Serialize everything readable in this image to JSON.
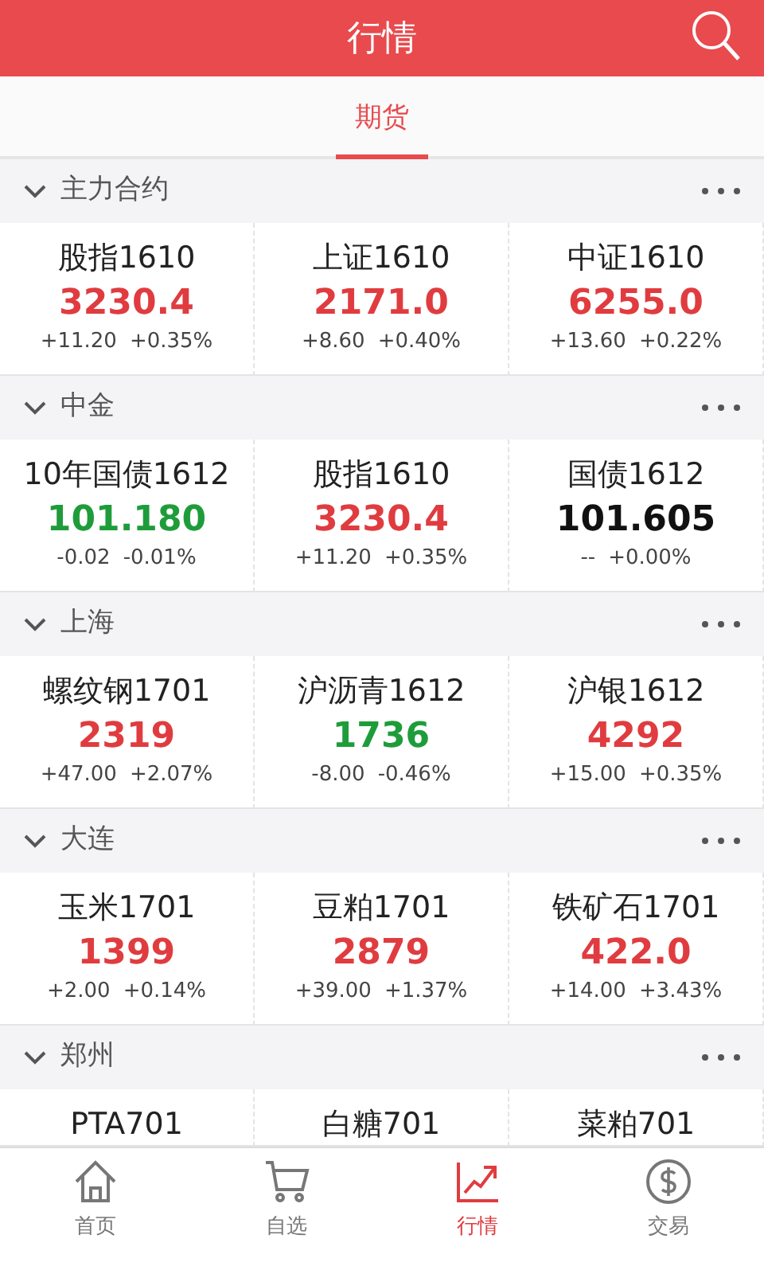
{
  "header": {
    "title": "行情"
  },
  "tabs": [
    {
      "label": "期货",
      "selected": true
    }
  ],
  "sections": [
    {
      "title": "主力合约",
      "expanded": true,
      "quotes": [
        {
          "name": "股指1610",
          "price": "3230.4",
          "change": "+11.20",
          "percent": "+0.35%",
          "kind": "up"
        },
        {
          "name": "上证1610",
          "price": "2171.0",
          "change": "+8.60",
          "percent": "+0.40%",
          "kind": "up"
        },
        {
          "name": "中证1610",
          "price": "6255.0",
          "change": "+13.60",
          "percent": "+0.22%",
          "kind": "up"
        }
      ]
    },
    {
      "title": "中金",
      "expanded": true,
      "quotes": [
        {
          "name": "10年国债1612",
          "price": "101.180",
          "change": "-0.02",
          "percent": "-0.01%",
          "kind": "down"
        },
        {
          "name": "股指1610",
          "price": "3230.4",
          "change": "+11.20",
          "percent": "+0.35%",
          "kind": "up"
        },
        {
          "name": "国债1612",
          "price": "101.605",
          "change": "--",
          "percent": "+0.00%",
          "kind": "flat"
        }
      ]
    },
    {
      "title": "上海",
      "expanded": true,
      "quotes": [
        {
          "name": "螺纹钢1701",
          "price": "2319",
          "change": "+47.00",
          "percent": "+2.07%",
          "kind": "up"
        },
        {
          "name": "沪沥青1612",
          "price": "1736",
          "change": "-8.00",
          "percent": "-0.46%",
          "kind": "down"
        },
        {
          "name": "沪银1612",
          "price": "4292",
          "change": "+15.00",
          "percent": "+0.35%",
          "kind": "up"
        }
      ]
    },
    {
      "title": "大连",
      "expanded": true,
      "quotes": [
        {
          "name": "玉米1701",
          "price": "1399",
          "change": "+2.00",
          "percent": "+0.14%",
          "kind": "up"
        },
        {
          "name": "豆粕1701",
          "price": "2879",
          "change": "+39.00",
          "percent": "+1.37%",
          "kind": "up"
        },
        {
          "name": "铁矿石1701",
          "price": "422.0",
          "change": "+14.00",
          "percent": "+3.43%",
          "kind": "up"
        }
      ]
    },
    {
      "title": "郑州",
      "expanded": true,
      "quotes": [
        {
          "name": "PTA701"
        },
        {
          "name": "白糖701"
        },
        {
          "name": "菜粕701"
        }
      ]
    }
  ],
  "bottom_nav": [
    {
      "label": "首页",
      "kind": "home",
      "selected": false
    },
    {
      "label": "自选",
      "kind": "cart",
      "selected": false
    },
    {
      "label": "行情",
      "kind": "chart",
      "selected": true
    },
    {
      "label": "交易",
      "kind": "dollar",
      "selected": false
    }
  ]
}
